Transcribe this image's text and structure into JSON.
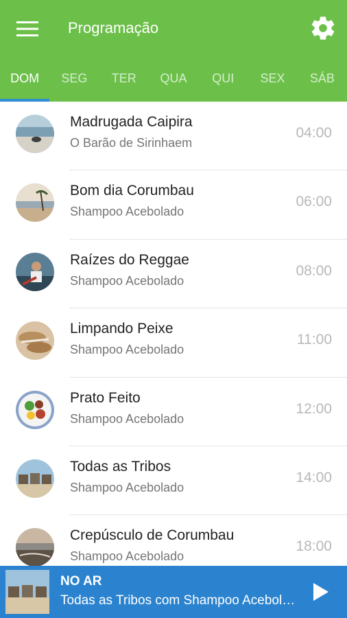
{
  "header": {
    "title": "Programação",
    "menu_icon": "hamburger-menu-icon",
    "settings_icon": "gear-icon",
    "color": "#6cc04a"
  },
  "tabs": [
    {
      "label": "DOM",
      "active": true
    },
    {
      "label": "SEG",
      "active": false
    },
    {
      "label": "TER",
      "active": false
    },
    {
      "label": "QUA",
      "active": false
    },
    {
      "label": "QUI",
      "active": false
    },
    {
      "label": "SEX",
      "active": false
    },
    {
      "label": "SÁB",
      "active": false
    }
  ],
  "schedule": [
    {
      "title": "Madrugada Caipira",
      "host": "O Barão de Sirinhaem",
      "time": "04:00"
    },
    {
      "title": "Bom dia Corumbau",
      "host": "Shampoo Acebolado",
      "time": "06:00"
    },
    {
      "title": "Raízes do Reggae",
      "host": "Shampoo Acebolado",
      "time": "08:00"
    },
    {
      "title": "Limpando Peixe",
      "host": "Shampoo Acebolado",
      "time": "11:00"
    },
    {
      "title": "Prato Feito",
      "host": "Shampoo Acebolado",
      "time": "12:00"
    },
    {
      "title": "Todas as Tribos",
      "host": "Shampoo Acebolado",
      "time": "14:00"
    },
    {
      "title": "Crepúsculo de Corumbau",
      "host": "Shampoo Acebolado",
      "time": "18:00"
    }
  ],
  "player": {
    "label": "NO AR",
    "now_playing": "Todas as Tribos com Shampoo Acebolado",
    "play_icon": "play-icon",
    "color": "#2b83cf"
  }
}
